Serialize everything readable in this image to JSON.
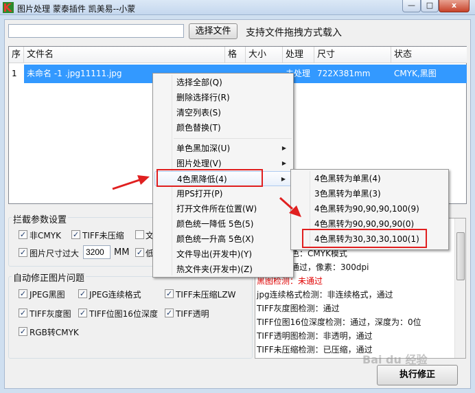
{
  "window": {
    "title": "图片处理   蒙泰插件 凯美易--小蒙",
    "minimize": "—",
    "maximize": "□",
    "close": "x"
  },
  "toolbar": {
    "path_value": "",
    "choose_file": "选择文件",
    "hint": "支持文件拖拽方式载入"
  },
  "table": {
    "headers": [
      "序",
      "文件名",
      "格式",
      "大小",
      "处理",
      "尺寸",
      "状态"
    ],
    "rows": [
      {
        "index": "1",
        "filename": "未命名 -1 .jpg11111.jpg",
        "format": "",
        "size": "",
        "process": "未处理",
        "dimensions": "722X381mm",
        "status": "CMYK,黑图"
      }
    ]
  },
  "intercept": {
    "title": "拦截参数设置",
    "non_cmyk": "非CMYK",
    "tiff_uncompressed": "TIFF未压缩",
    "third": "文",
    "too_large": "图片尺寸过大",
    "size_value": "3200",
    "unit": "MM",
    "low": "低"
  },
  "autofix": {
    "title": "自动修正图片问题",
    "jpeg_black": "JPEG黑图",
    "jpeg_progressive": "JPEG连续格式",
    "tiff_lzw": "TIFF未压缩LZW",
    "tiff_gray": "TIFF灰度图",
    "tiff_16bit": "TIFF位图16位深度",
    "tiff_transparent": "TIFF透明",
    "rgb_to_cmyk": "RGB转CMYK"
  },
  "log": {
    "lines": [
      "模式颜色：CMYK模式",
      "检测：通过，像素：300dpi",
      "黑图检测：未通过",
      "jpg连续格式检测：非连续格式，通过",
      "TIFF灰度图检测：通过",
      "TIFF位图16位深度检测：通过，深度为：0位",
      "TIFF透明图检测：非透明，通过",
      "TIFF未压缩检测：已压缩，通过"
    ]
  },
  "run_button": "执行修正",
  "context_menu": {
    "items": [
      "选择全部(Q)",
      "删除选择行(R)",
      "清空列表(S)",
      "颜色替换(T)",
      "单色黑加深(U)",
      "图片处理(V)",
      "4色黑降低(4)",
      "用PS打开(P)",
      "打开文件所在位置(W)",
      "颜色统一降低 5色(5)",
      "颜色统一升高 5色(X)",
      "文件导出(开发中)(Y)",
      "热文件夹(开发中)(Z)"
    ]
  },
  "submenu": {
    "items": [
      "4色黑转为单黑(4)",
      "3色黑转为单黑(3)",
      "4色黑转为90,90,90,100(9)",
      "4色黑转为90,90,90,90(0)",
      "4色黑转为30,30,30,100(1)"
    ]
  },
  "watermark": "Bai du 经验",
  "colors": {
    "selection": "#3399ff",
    "highlight_box": "#e01e1e",
    "error_text": "#e00000"
  }
}
